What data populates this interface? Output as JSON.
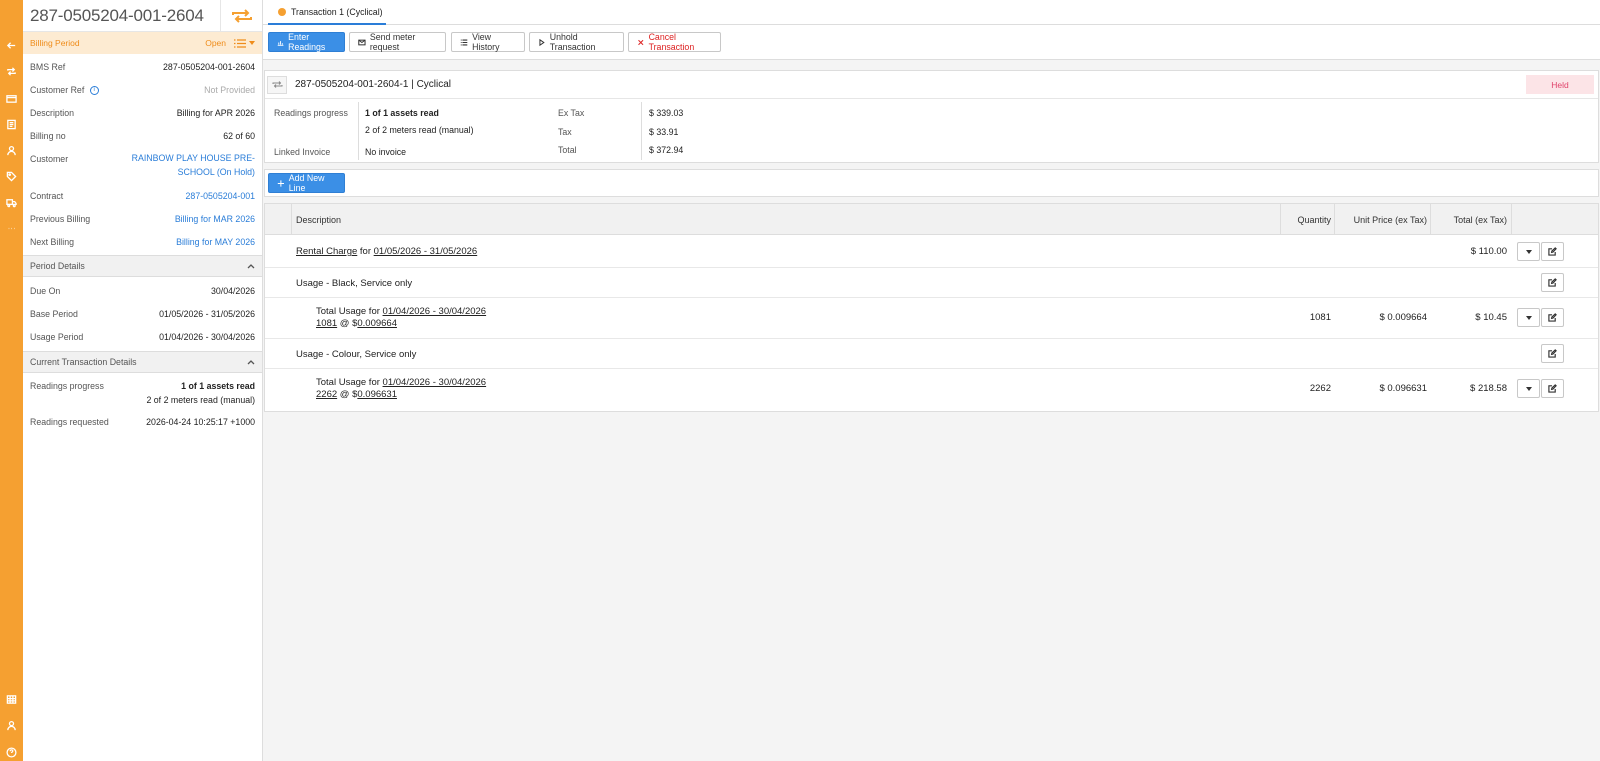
{
  "header": {
    "id": "287-0505204-001-2604"
  },
  "billing_bar": {
    "label": "Billing Period",
    "status": "Open"
  },
  "details": [
    {
      "key": "BMS Ref",
      "value": "287-0505204-001-2604"
    },
    {
      "key": "Customer Ref",
      "value": "Not Provided"
    },
    {
      "key": "Description",
      "value": "Billing for APR 2026"
    },
    {
      "key": "Billing no",
      "value": "62 of 60"
    },
    {
      "key": "Customer",
      "value": "RAINBOW PLAY HOUSE PRE-SCHOOL (On Hold)"
    },
    {
      "key": "Contract",
      "value": "287-0505204-001"
    },
    {
      "key": "Previous Billing",
      "value": "Billing for MAR 2026"
    },
    {
      "key": "Next Billing",
      "value": "Billing for MAY 2026"
    }
  ],
  "period_details": {
    "title": "Period Details",
    "rows": [
      {
        "key": "Due On",
        "value": "30/04/2026"
      },
      {
        "key": "Base Period",
        "value": "01/05/2026 - 31/05/2026"
      },
      {
        "key": "Usage Period",
        "value": "01/04/2026 - 30/04/2026"
      }
    ]
  },
  "current_tx": {
    "title": "Current Transaction Details",
    "progress_key": "Readings progress",
    "progress_1": "1 of 1 assets read",
    "progress_2": "2 of 2 meters read (manual)",
    "requested_key": "Readings requested",
    "requested_value": "2026-04-24 10:25:17 +1000"
  },
  "tab": {
    "label": "Transaction 1 (Cyclical)"
  },
  "toolbar": {
    "enter_readings": "Enter Readings",
    "send_meter_request": "Send meter request",
    "view_history": "View History",
    "unhold": "Unhold Transaction",
    "cancel": "Cancel Transaction"
  },
  "tx_card": {
    "title": "287-0505204-001-2604-1 | Cyclical",
    "status": "Held",
    "progress_label": "Readings progress",
    "progress_1": "1 of 1 assets read",
    "progress_2": "2 of 2 meters read (manual)",
    "linked_label": "Linked Invoice",
    "linked_value": "No invoice",
    "ex_tax_label": "Ex Tax",
    "ex_tax_value": "$ 339.03",
    "tax_label": "Tax",
    "tax_value": "$ 33.91",
    "total_label": "Total",
    "total_value": "$ 372.94"
  },
  "add_line": {
    "label": "Add New Line"
  },
  "table": {
    "headers": {
      "description": "Description",
      "quantity": "Quantity",
      "unit_price": "Unit Price (ex Tax)",
      "total": "Total (ex Tax)"
    },
    "rental": {
      "name": "Rental Charge",
      "for": " for ",
      "period": "01/05/2026 - 31/05/2026",
      "total": "$ 110.00"
    },
    "black_group": "Usage - Black, Service only",
    "black_line": {
      "prefix": "Total Usage for ",
      "period": "01/04/2026 - 30/04/2026",
      "qty_link": "1081",
      "at": " @ $",
      "rate_link": "0.009664",
      "quantity": "1081",
      "unit_price": "$ 0.009664",
      "total": "$ 10.45"
    },
    "colour_group": "Usage - Colour, Service only",
    "colour_line": {
      "prefix": "Total Usage for ",
      "period": "01/04/2026 - 30/04/2026",
      "qty_link": "2262",
      "at": " @ $",
      "rate_link": "0.096631",
      "quantity": "2262",
      "unit_price": "$ 0.096631",
      "total": "$ 218.58"
    }
  },
  "icons": [
    "back-arrow-icon",
    "repeat-icon",
    "card-icon",
    "document-icon",
    "user-icon",
    "tag-icon",
    "truck-icon",
    "more-icon",
    "grid-icon",
    "profile-icon",
    "help-icon"
  ],
  "colors": {
    "accent": "#f5a031",
    "primary": "#3b8fe6",
    "link": "#2a7dd8",
    "danger": "#dd2222",
    "held_bg": "#fce4e7"
  }
}
